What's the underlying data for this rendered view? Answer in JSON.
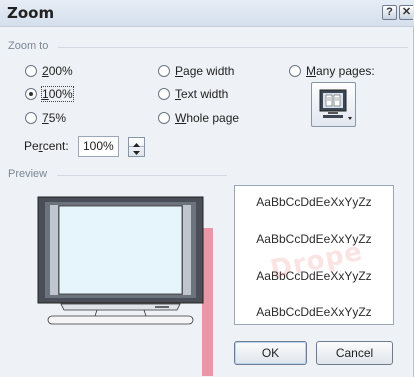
{
  "dialog": {
    "title": "Zoom",
    "help_glyph": "?",
    "close_glyph": "✕"
  },
  "zoom_to": {
    "label": "Zoom to",
    "options": [
      {
        "key": "2",
        "rest": "00%",
        "checked": false
      },
      {
        "key": "1",
        "rest": "00%",
        "checked": true
      },
      {
        "key": "7",
        "rest": "5%",
        "checked": false
      },
      {
        "key": "P",
        "rest": "age width",
        "checked": false
      },
      {
        "key": "T",
        "rest": "ext width",
        "checked": false
      },
      {
        "key": "W",
        "rest": "hole page",
        "checked": false
      },
      {
        "key": "M",
        "rest": "any pages:",
        "checked": false
      }
    ]
  },
  "percent": {
    "label_pre": "Pe",
    "label_key": "r",
    "label_post": "cent:",
    "value": "100%"
  },
  "preview": {
    "label": "Preview",
    "sample_text": [
      "AaBbCcDdEeXxYyZz",
      "AaBbCcDdEeXxYyZz",
      "AaBbCcDdEeXxYyZz",
      "AaBbCcDdEeXxYyZz"
    ],
    "watermark": "Drope"
  },
  "buttons": {
    "ok": "OK",
    "cancel": "Cancel"
  },
  "icons": {
    "help": "help-icon",
    "close": "close-icon",
    "many_pages": "monitor-pages-icon",
    "spin_up": "chevron-up-icon",
    "spin_down": "chevron-down-icon",
    "preview": "monitor-preview-icon"
  }
}
